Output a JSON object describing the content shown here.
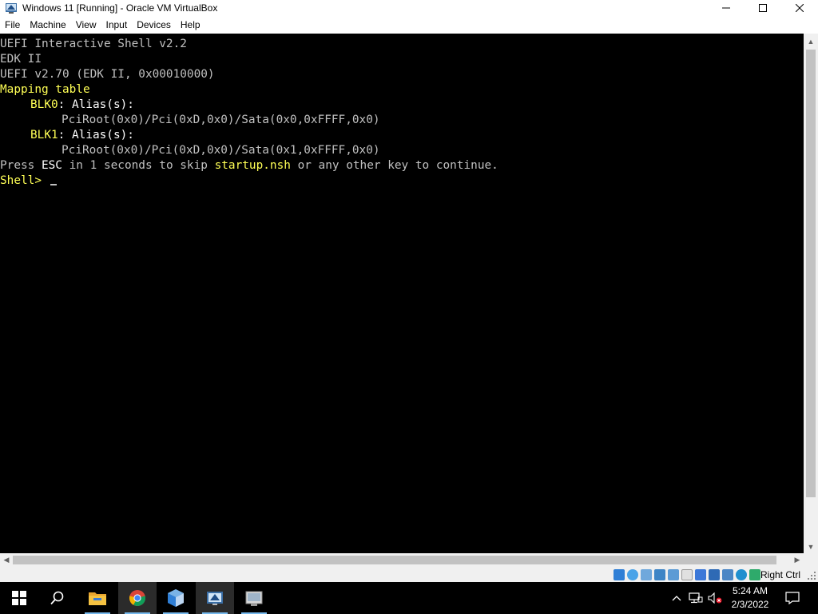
{
  "window": {
    "title": "Windows 11 [Running] - Oracle VM VirtualBox"
  },
  "menu": {
    "items": [
      "File",
      "Machine",
      "View",
      "Input",
      "Devices",
      "Help"
    ]
  },
  "console": {
    "line1": "UEFI Interactive Shell v2.2",
    "line2": "EDK II",
    "line3": "UEFI v2.70 (EDK II, 0x00010000)",
    "line4": "Mapping table",
    "blk0_name": "BLK0",
    "blk0_sep": ": Alias(s):",
    "blk0_path": "PciRoot(0x0)/Pci(0xD,0x0)/Sata(0x0,0xFFFF,0x0)",
    "blk1_name": "BLK1",
    "blk1_sep": ": Alias(s):",
    "blk1_path": "PciRoot(0x0)/Pci(0xD,0x0)/Sata(0x1,0xFFFF,0x0)",
    "press_a": "Press ",
    "press_esc": "ESC",
    "press_b": " in 1 seconds to skip ",
    "press_file": "startup.nsh",
    "press_c": " or any other key to continue.",
    "prompt": "Shell> "
  },
  "statusbar": {
    "host_key": "Right Ctrl",
    "icons": [
      "hard-disk-icon",
      "optical-drive-icon",
      "audio-icon",
      "network-icon",
      "usb-icon",
      "shared-folders-icon",
      "display-icon",
      "video-capture-icon",
      "mouse-integration-icon",
      "host-key-icon"
    ]
  },
  "taskbar": {
    "time": "5:24 AM",
    "date": "2/3/2022",
    "apps": [
      "start-icon",
      "search-icon",
      "file-explorer-icon",
      "chrome-icon",
      "virtualbox-icon",
      "virtualbox-vm-icon",
      "app-icon"
    ]
  }
}
